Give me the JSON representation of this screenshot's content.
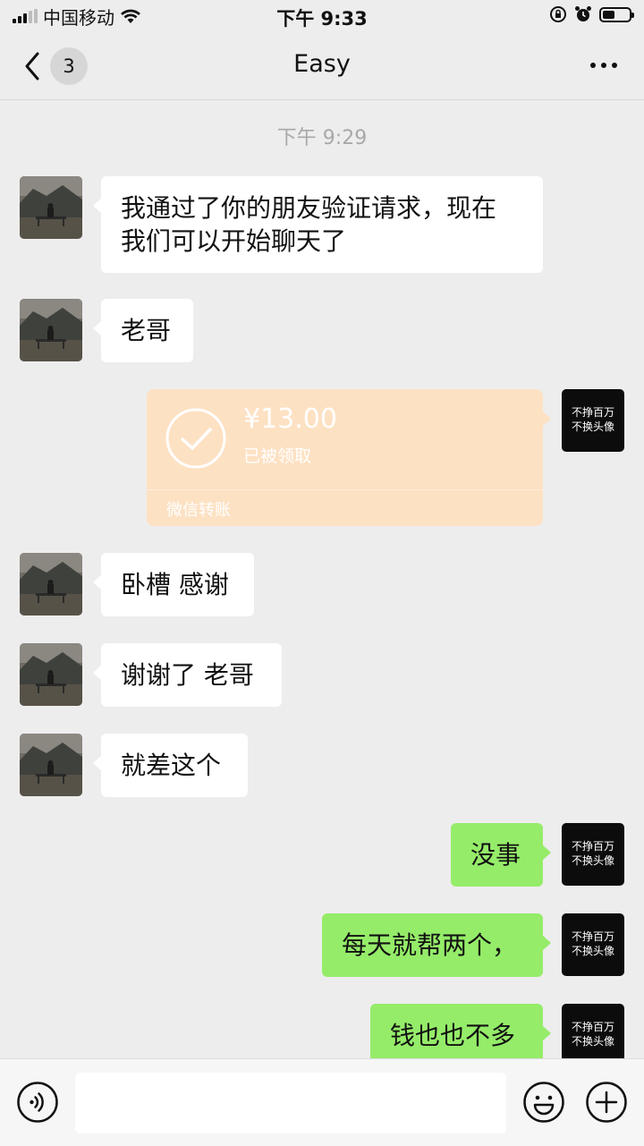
{
  "status_bar": {
    "carrier": "中国移动",
    "time": "下午 9:33",
    "icons": [
      "signal-icon",
      "wifi-icon",
      "orientation-lock-icon",
      "alarm-icon",
      "battery-icon"
    ],
    "battery_level": 0.45
  },
  "nav": {
    "back_badge": "3",
    "title": "Easy",
    "icons": [
      "back-chevron-icon",
      "more-icon"
    ]
  },
  "chat": {
    "timestamp": "下午 9:29",
    "self_avatar_text": [
      "不挣百万",
      "不换头像"
    ],
    "messages": [
      {
        "sender": "friend",
        "text_lines": [
          "我通过了你的朋友验证请求，现在",
          "我们可以开始聊天了"
        ]
      },
      {
        "sender": "friend",
        "text": "老哥"
      },
      {
        "sender": "self",
        "type": "transfer",
        "amount": "¥13.00",
        "status": "已被领取",
        "label": "微信转账",
        "icon": "check-circle-icon"
      },
      {
        "sender": "friend",
        "text": "卧槽 感谢"
      },
      {
        "sender": "friend",
        "text": "谢谢了 老哥"
      },
      {
        "sender": "friend",
        "text": "就差这个"
      },
      {
        "sender": "self",
        "text": "没事"
      },
      {
        "sender": "self",
        "text": "每天就帮两个，"
      },
      {
        "sender": "self",
        "text": "钱也也不多"
      }
    ]
  },
  "input_bar": {
    "value": "",
    "icons": [
      "voice-icon",
      "emoji-icon",
      "plus-icon"
    ]
  },
  "colors": {
    "background": "#ededed",
    "self_bubble": "#95ec69",
    "friend_bubble": "#ffffff",
    "transfer_card": "#fde1c3",
    "timestamp_text": "#a8a8a8"
  }
}
